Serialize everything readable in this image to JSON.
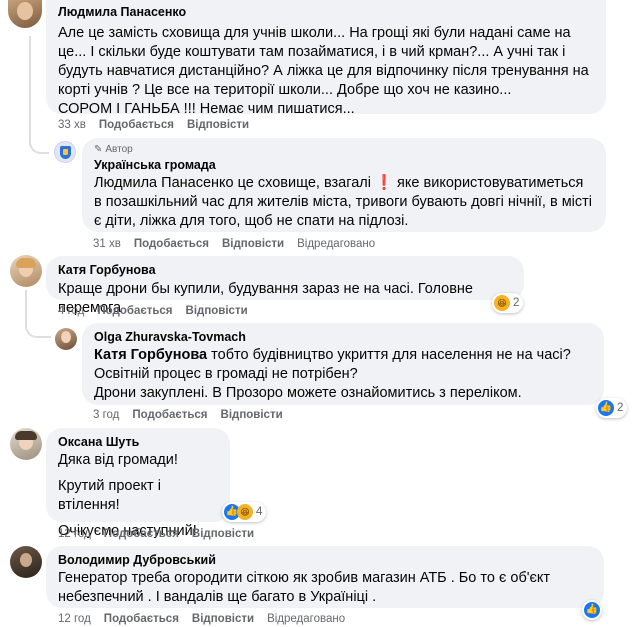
{
  "comments": [
    {
      "author": "Людмила Панасенко",
      "text": "Але це замість сховища для учнів школи... На грощі які були надані саме на це... І скільки буде коштувати там позайматися, і в чий крман?... А учні так і будуть навчатися дистанційно? А ліжка це для відпочинку після тренування на корті учнів ? Це все на території школи... Добре що хоч не казино...\nСОРОМ І ГАНЬБА !!! Немає чим пишатися...",
      "time": "33 хв",
      "like_label": "Подобається",
      "reply_label": "Відповісти"
    },
    {
      "author_badge": "Автор",
      "author": "Українська громада",
      "mention": "Людмила Панасенко",
      "text_before": " це сховище, взагалі ",
      "excl_icon": "❗",
      "text_after": " яке використовуватиметься в позашкільний час для жителів міста, тривоги бувають довгі нічнії, в місті є діти, ліжка для того, щоб не спати на підлозі.",
      "time": "31 хв",
      "like_label": "Подобається",
      "reply_label": "Відповісти",
      "edited_label": "Відредаговано"
    },
    {
      "author": "Катя Горбунова",
      "text": "Краще дрони бы купили, будування зараз не на часі. Головне перемога",
      "time": "4 год",
      "like_label": "Подобається",
      "reply_label": "Відповісти",
      "reactions": {
        "icons": [
          "haha"
        ],
        "count": "2"
      }
    },
    {
      "author": "Olga Zhuravska-Tovmach",
      "mention": "Катя Горбунова",
      "text_line1": " тобто будівництво укриття для населення не на часі? Освітній процес в громаді не потрібен?",
      "text_line2": "Дрони закуплені. В Прозоро можете ознайомитись з переліком.",
      "time": "3 год",
      "like_label": "Подобається",
      "reply_label": "Відповісти",
      "reactions": {
        "icons": [
          "like"
        ],
        "count": "2"
      }
    },
    {
      "author": "Оксана Шуть",
      "paragraphs": [
        "Дяка від громади!",
        "Крутий проект і втілення!",
        "Очікуємо наступний!"
      ],
      "time": "12 год",
      "like_label": "Подобається",
      "reply_label": "Відповісти",
      "reactions": {
        "icons": [
          "like",
          "haha"
        ],
        "count": "4"
      }
    },
    {
      "author": "Володимир Дубровський",
      "text": "Генератор треба огородити сіткою як зробив магазин АТБ . Бо то є об'єкт небезпечний . І вандалів ще багато в Україніці .",
      "time": "12 год",
      "like_label": "Подобається",
      "reply_label": "Відповісти",
      "edited_label": "Відредаговано",
      "reactions": {
        "icons": [
          "like"
        ],
        "count": ""
      }
    }
  ],
  "colors": {
    "bubble_bg": "#f0f2f5",
    "meta_text": "#65676b",
    "like_blue": "#1877f2",
    "haha_yellow": "#f7b125",
    "exclamation_red": "#e41e3f"
  }
}
